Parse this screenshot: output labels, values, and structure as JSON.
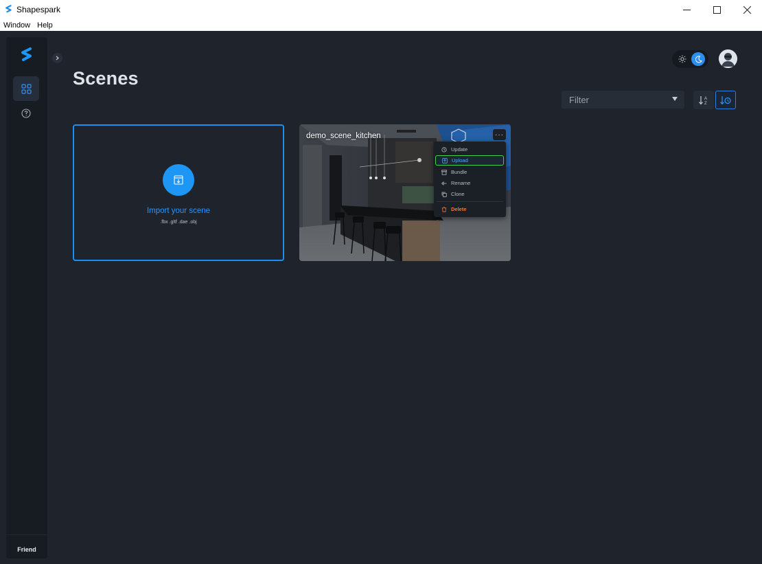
{
  "window": {
    "title": "Shapespark",
    "controls": [
      "minimize-icon",
      "maximize-icon",
      "close-icon"
    ]
  },
  "menubar": {
    "items": [
      "Window",
      "Help"
    ]
  },
  "sidebar": {
    "nav": [
      {
        "name": "scenes",
        "icon": "grid-icon",
        "active": true
      },
      {
        "name": "help",
        "icon": "help-circle-icon",
        "active": false
      }
    ],
    "user_label": "Friend"
  },
  "header": {
    "title": "Scenes",
    "theme": {
      "mode": "dark"
    }
  },
  "toolbar": {
    "filter_placeholder": "Filter",
    "sort_options": [
      "sort-alpha-icon",
      "sort-date-icon"
    ],
    "active_sort": "date"
  },
  "import_card": {
    "label": "Import your scene",
    "formats": ".fbx .gltf .dae .obj"
  },
  "scenes": [
    {
      "title": "demo_scene_kitchen",
      "more_label": "···"
    }
  ],
  "context_menu": {
    "items": [
      {
        "label": "Update",
        "icon": "history-icon"
      },
      {
        "label": "Upload",
        "icon": "upload-icon",
        "highlighted": true
      },
      {
        "label": "Bundle",
        "icon": "archive-icon"
      },
      {
        "label": "Rename",
        "icon": "rename-icon"
      },
      {
        "label": "Clone",
        "icon": "copy-icon"
      },
      {
        "label": "Delete",
        "icon": "trash-icon",
        "danger": true
      }
    ]
  },
  "colors": {
    "accent": "#1e96f5",
    "background": "#1e232c",
    "sidebar": "#171b22",
    "danger": "#f07a3a",
    "highlight_border": "#41d14a"
  }
}
